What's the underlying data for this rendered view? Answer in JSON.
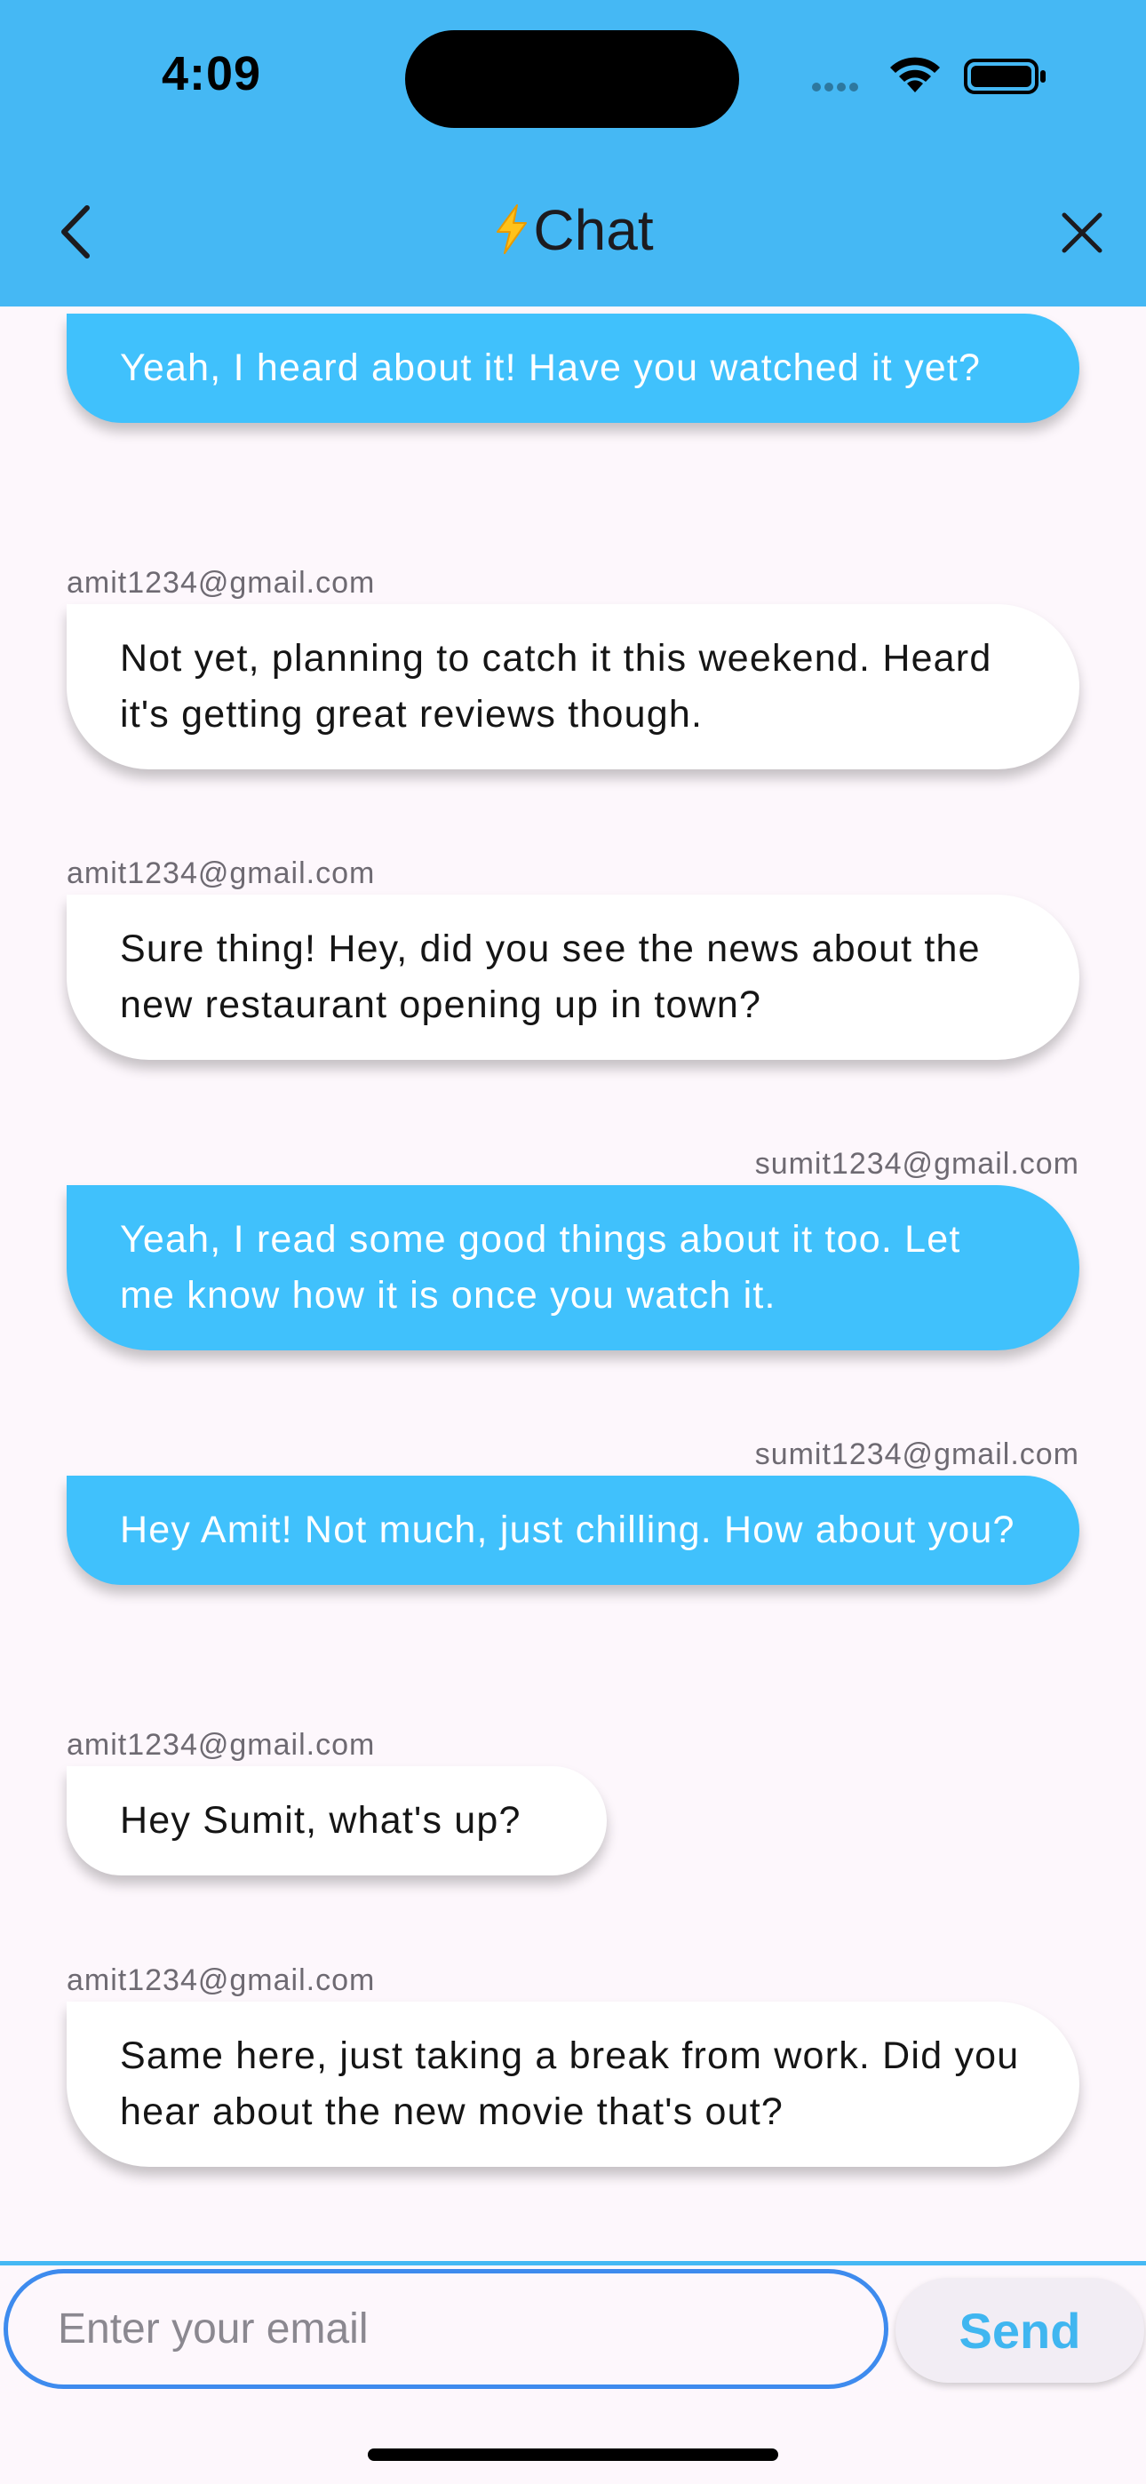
{
  "status_bar": {
    "time": "4:09"
  },
  "header": {
    "title": "Chat",
    "title_icon": "lightning-bolt-icon",
    "background": "#45B8F4"
  },
  "messages": [
    {
      "sender": "",
      "text": "Yeah, I heard about it! Have you watched it yet?",
      "type": "sent"
    },
    {
      "sender": "amit1234@gmail.com",
      "text": "Not yet, planning to catch it this weekend. Heard it's getting great reviews though.",
      "type": "received"
    },
    {
      "sender": "amit1234@gmail.com",
      "text": "Sure thing! Hey, did you see the news about the new restaurant opening up in town?",
      "type": "received"
    },
    {
      "sender": "sumit1234@gmail.com",
      "text": "Yeah, I read some good things about it too. Let me know how it is once you watch it.",
      "type": "sent"
    },
    {
      "sender": "sumit1234@gmail.com",
      "text": "Hey Amit! Not much, just chilling. How about you?",
      "type": "sent"
    },
    {
      "sender": "amit1234@gmail.com",
      "text": "Hey Sumit, what's up?",
      "type": "received"
    },
    {
      "sender": "amit1234@gmail.com",
      "text": "Same here, just taking a break from work. Did you hear about the new movie that's out?",
      "type": "received"
    }
  ],
  "composer": {
    "placeholder": "Enter your email",
    "value": "",
    "send_label": "Send"
  },
  "colors": {
    "sent_bubble": "#40C1FC",
    "received_bubble": "#FFFFFF",
    "accent": "#45B8F4",
    "input_border": "#3E8BEE"
  }
}
